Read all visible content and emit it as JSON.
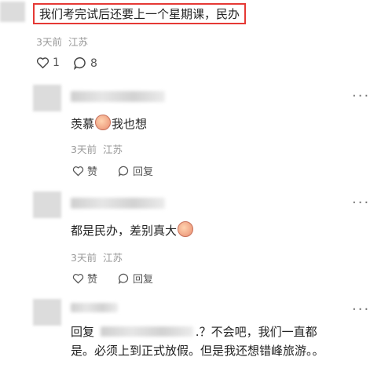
{
  "top_comment": {
    "text": "我们考完试后还要上一个星期课，民办",
    "time": "3天前",
    "location": "江苏",
    "like_count": "1",
    "reply_count": "8"
  },
  "replies": [
    {
      "text_before": "羡慕",
      "text_after": "我也想",
      "time": "3天前",
      "location": "江苏",
      "like_label": "赞",
      "reply_label": "回复",
      "more": "···"
    },
    {
      "text_before": "都是民办，差别真大",
      "text_after": "",
      "time": "3天前",
      "location": "江苏",
      "like_label": "赞",
      "reply_label": "回复",
      "more": "···"
    },
    {
      "reply_prefix": "回复",
      "line1_rest": ".？不会吧，我们一直都",
      "line2": "是。必须上到正式放假。但是我还想错峰旅游。。",
      "more": "···"
    }
  ]
}
